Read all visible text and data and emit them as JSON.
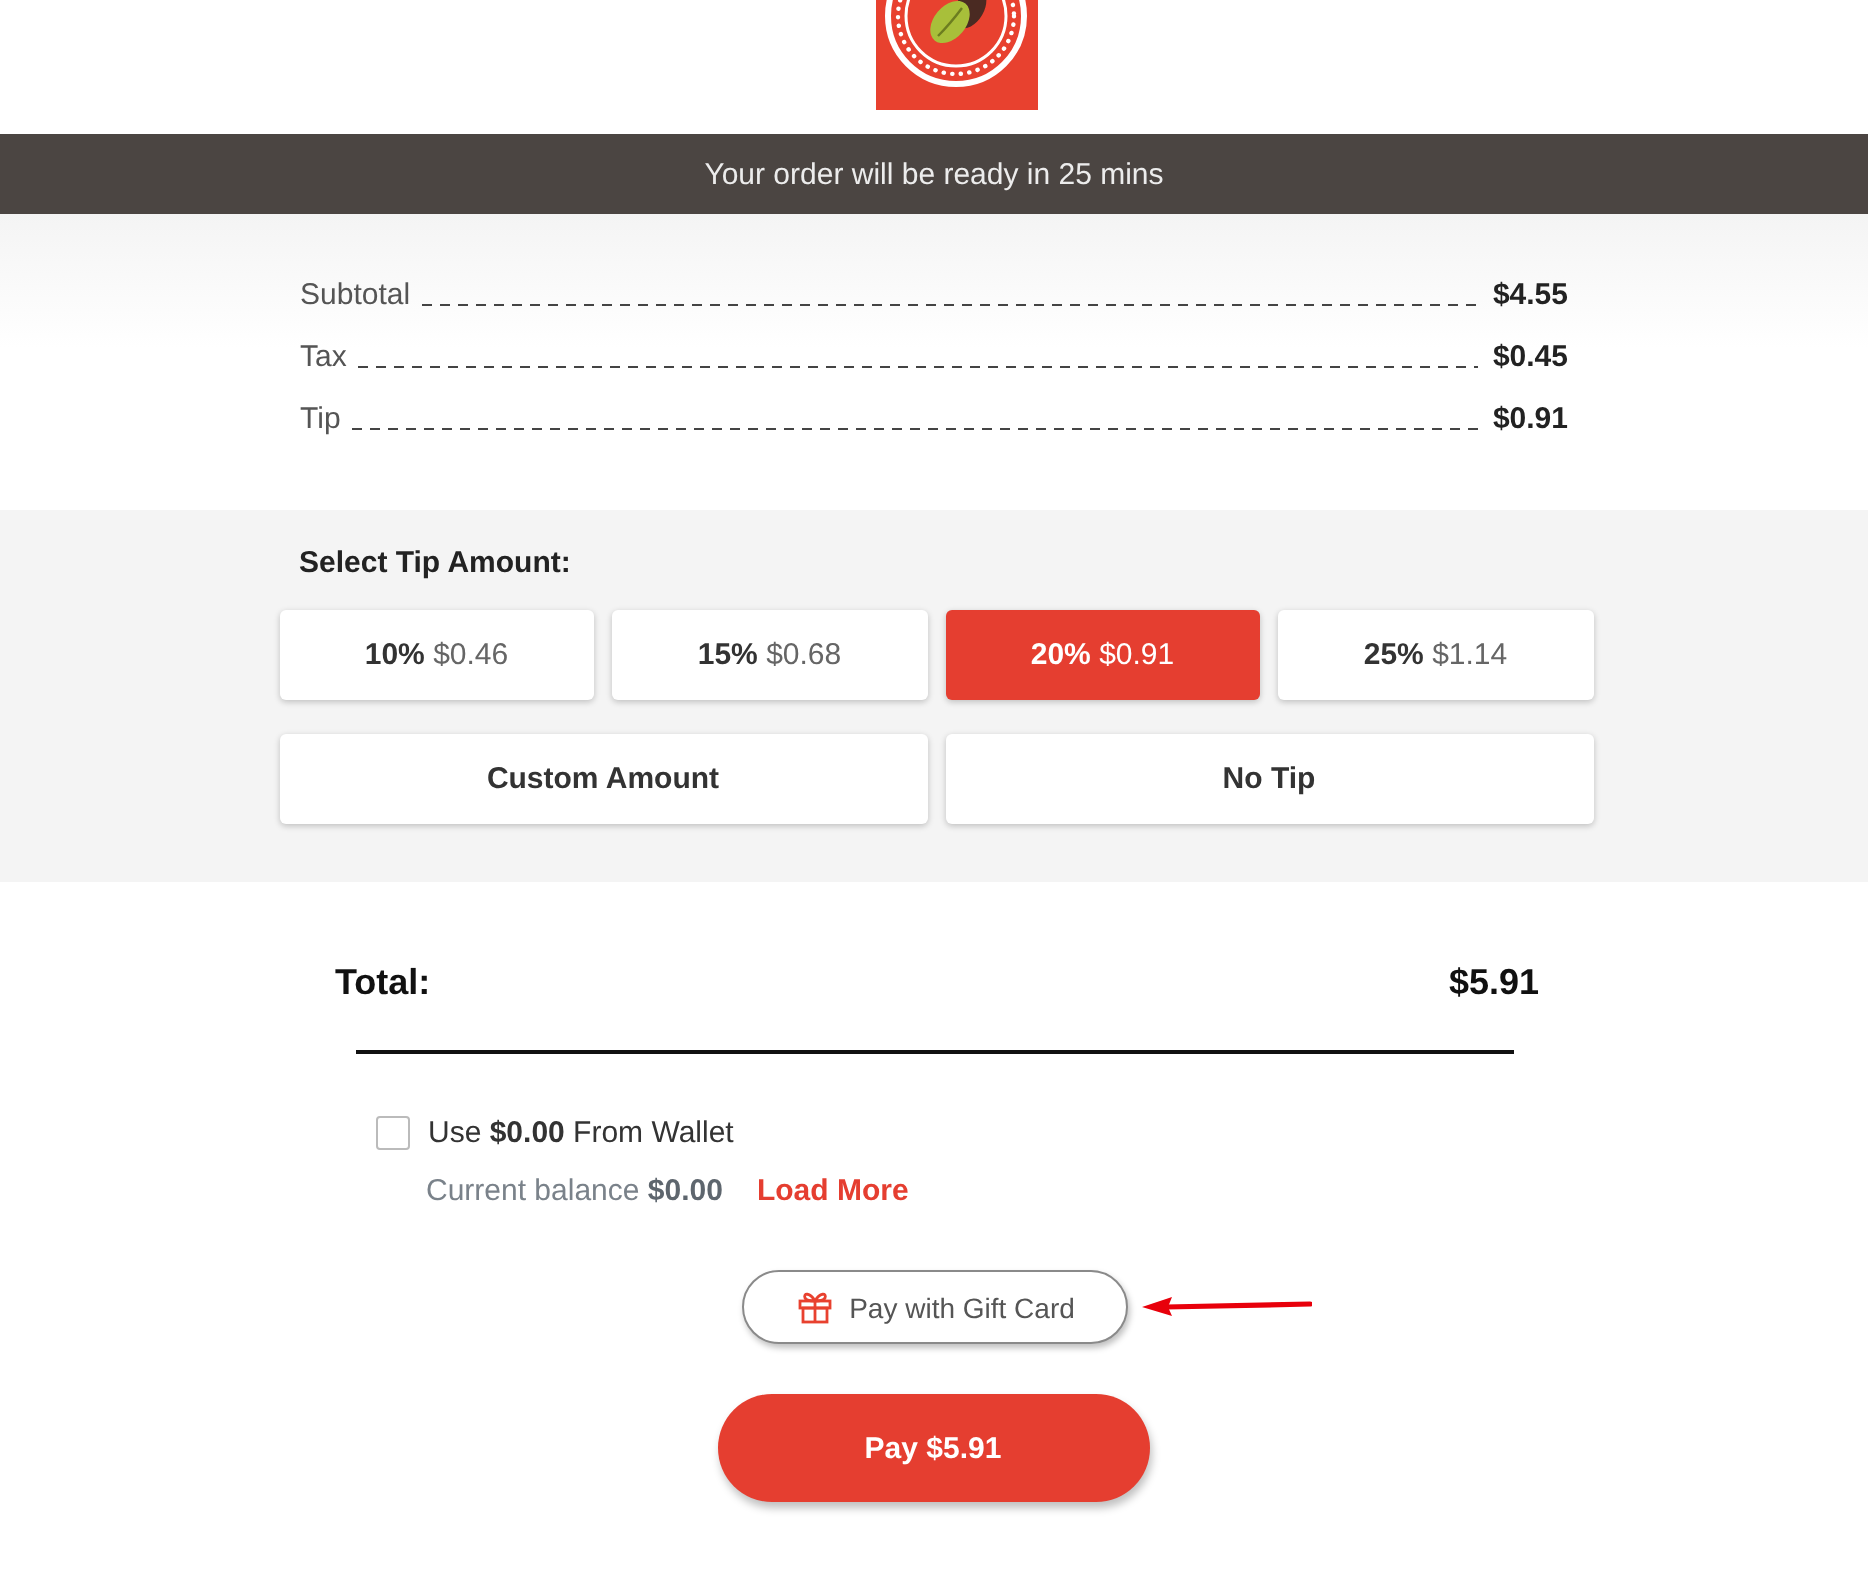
{
  "banner": {
    "text": "Your order will be ready in 25 mins"
  },
  "summary": [
    {
      "label": "Subtotal",
      "value": "$4.55"
    },
    {
      "label": "Tax",
      "value": "$0.45"
    },
    {
      "label": "Tip",
      "value": "$0.91"
    }
  ],
  "tip": {
    "title": "Select Tip Amount:",
    "options": [
      {
        "percent": "10%",
        "amount": "$0.46",
        "selected": false
      },
      {
        "percent": "15%",
        "amount": "$0.68",
        "selected": false
      },
      {
        "percent": "20%",
        "amount": "$0.91",
        "selected": true
      },
      {
        "percent": "25%",
        "amount": "$1.14",
        "selected": false
      }
    ],
    "extra_options": [
      {
        "label": "Custom Amount",
        "selected": false
      },
      {
        "label": "No Tip",
        "selected": false
      }
    ]
  },
  "total": {
    "label": "Total:",
    "value": "$5.91"
  },
  "wallet": {
    "checked": false,
    "text": "Use **$0.00** From Wallet",
    "balance": "Current balance **$0.00**",
    "link": "Load More"
  },
  "gift_card_button": {
    "label": "Pay with Gift Card"
  },
  "pay_button": {
    "label": "Pay $5.91"
  }
}
